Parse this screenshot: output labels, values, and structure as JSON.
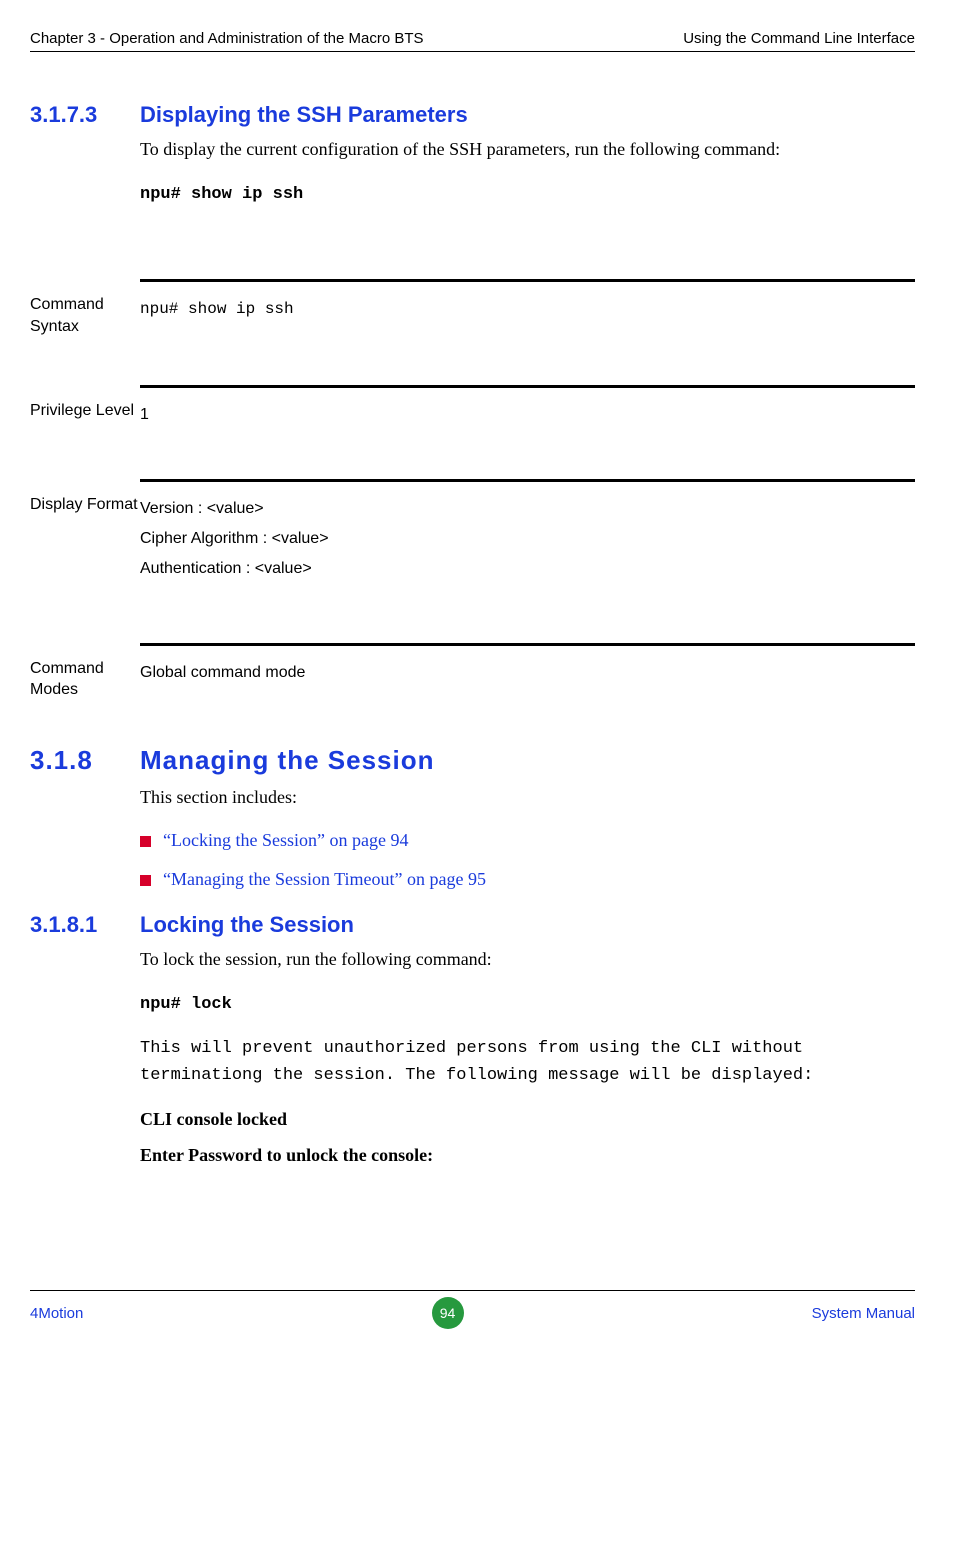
{
  "header": {
    "left": "Chapter 3 - Operation and Administration of the Macro BTS",
    "right": "Using the Command Line Interface"
  },
  "s31733": {
    "num": "3.1.7.3",
    "title": "Displaying the SSH Parameters",
    "intro": "To display the current configuration of the SSH parameters, run the following command:",
    "cmd": "npu# show ip ssh"
  },
  "blocks": {
    "syntax_label": "Command Syntax",
    "syntax_value": "npu# show ip ssh",
    "priv_label": "Privilege Level",
    "priv_value": "1",
    "disp_label": "Display Format",
    "disp_line1": "Version          : <value>",
    "disp_line2": "Cipher Algorithm : <value>",
    "disp_line3": "Authentication   : <value>",
    "modes_label": "Command Modes",
    "modes_value": "Global command mode"
  },
  "s318": {
    "num": "3.1.8",
    "title": "Managing the Session",
    "intro": "This section includes:",
    "bullet1": "“Locking the Session” on page 94",
    "bullet2": "“Managing the Session Timeout” on page 95"
  },
  "s3181": {
    "num": "3.1.8.1",
    "title": "Locking the Session",
    "intro": "To lock the session, run the following command:",
    "cmd": "npu# lock",
    "note": "This will prevent unauthorized persons from using the CLI without terminationg the session. The following message will be displayed:",
    "msg1": "CLI console locked",
    "msg2": "Enter Password to unlock the console:"
  },
  "footer": {
    "left": "4Motion",
    "page": "94",
    "right": "System Manual"
  }
}
